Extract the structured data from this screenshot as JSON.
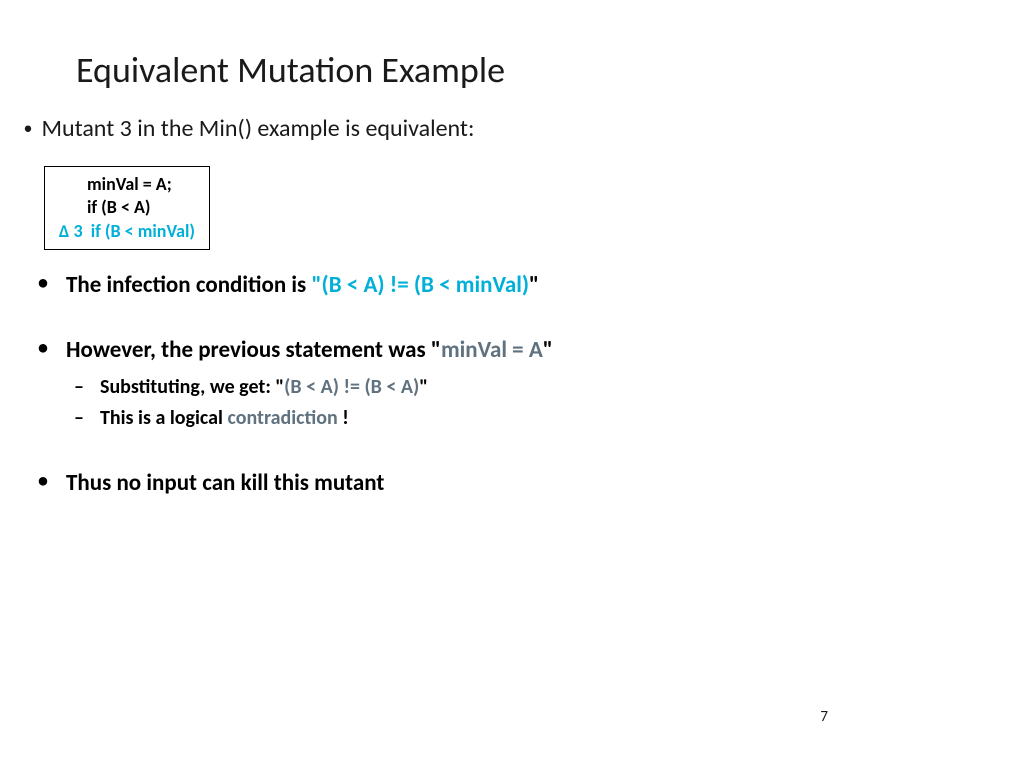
{
  "title": "Equivalent Mutation Example",
  "intro": "Mutant 3 in the Min() example is equivalent:",
  "code": {
    "line1": "minVal = A;",
    "line2": "if (B < A)",
    "line3": "∆ 3  if (B < minVal)"
  },
  "bullets": {
    "b1_prefix": "The infection condition is ",
    "b1_open": "\"",
    "b1_highlight": "(B < A) != (B < minVal)",
    "b1_close": "\"",
    "b2_prefix": "However, the previous statement was \"",
    "b2_highlight": "minVal = A",
    "b2_close": "\"",
    "b2_sub1_prefix": "Substituting, we get: \"",
    "b2_sub1_highlight": "(B < A) != (B < A)",
    "b2_sub1_close": "\"",
    "b2_sub2_prefix": "This is a logical ",
    "b2_sub2_highlight": "contradiction",
    "b2_sub2_suffix": " !",
    "b3": "Thus no input can kill this mutant"
  },
  "pageNumber": "7"
}
